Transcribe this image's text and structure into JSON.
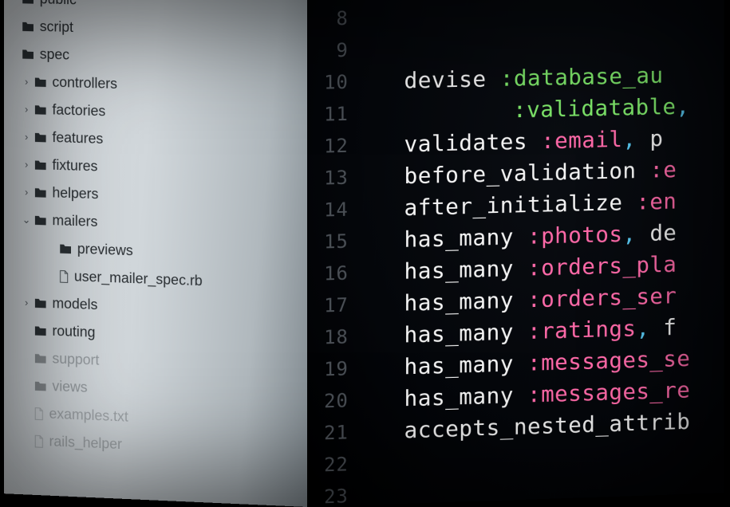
{
  "sidebar": {
    "items": [
      {
        "label": "public",
        "depth": 0,
        "arrow": "",
        "icon": "folder",
        "cls": ""
      },
      {
        "label": "script",
        "depth": 0,
        "arrow": "",
        "icon": "folder",
        "cls": ""
      },
      {
        "label": "spec",
        "depth": 0,
        "arrow": "",
        "icon": "folder",
        "cls": ""
      },
      {
        "label": "controllers",
        "depth": 1,
        "arrow": "›",
        "icon": "folder",
        "cls": ""
      },
      {
        "label": "factories",
        "depth": 1,
        "arrow": "›",
        "icon": "folder",
        "cls": ""
      },
      {
        "label": "features",
        "depth": 1,
        "arrow": "›",
        "icon": "folder",
        "cls": ""
      },
      {
        "label": "fixtures",
        "depth": 1,
        "arrow": "›",
        "icon": "folder",
        "cls": ""
      },
      {
        "label": "helpers",
        "depth": 1,
        "arrow": "›",
        "icon": "folder",
        "cls": ""
      },
      {
        "label": "mailers",
        "depth": 1,
        "arrow": "⌄",
        "icon": "folder",
        "cls": ""
      },
      {
        "label": "previews",
        "depth": 2,
        "arrow": "",
        "icon": "folder",
        "cls": ""
      },
      {
        "label": "user_mailer_spec.rb",
        "depth": 2,
        "arrow": "",
        "icon": "file",
        "cls": ""
      },
      {
        "label": "models",
        "depth": 1,
        "arrow": "›",
        "icon": "folder",
        "cls": ""
      },
      {
        "label": "routing",
        "depth": 1,
        "arrow": "",
        "icon": "folder",
        "cls": ""
      },
      {
        "label": "support",
        "depth": 1,
        "arrow": "",
        "icon": "folder",
        "cls": "faded"
      },
      {
        "label": "views",
        "depth": 1,
        "arrow": "",
        "icon": "folder",
        "cls": "faded"
      },
      {
        "label": "examples.txt",
        "depth": 1,
        "arrow": "",
        "icon": "file",
        "cls": "veryfaded"
      },
      {
        "label": "rails_helper",
        "depth": 1,
        "arrow": "",
        "icon": "file",
        "cls": "veryfaded"
      }
    ]
  },
  "editor": {
    "line_numbers": [
      "8",
      "9",
      "10",
      "11",
      "12",
      "13",
      "14",
      "15",
      "16",
      "17",
      "18",
      "19",
      "20",
      "21",
      "22",
      "23"
    ],
    "lines": [
      {
        "tokens": []
      },
      {
        "tokens": []
      },
      {
        "tokens": [
          {
            "t": "indent"
          },
          {
            "t": "kw",
            "v": "devise "
          },
          {
            "t": "sym2",
            "v": ":database_au"
          }
        ]
      },
      {
        "tokens": [
          {
            "t": "bigindent"
          },
          {
            "t": "sym2",
            "v": ":validatable"
          },
          {
            "t": "pun",
            "v": ","
          }
        ]
      },
      {
        "tokens": [
          {
            "t": "indent"
          },
          {
            "t": "kw",
            "v": "validates "
          },
          {
            "t": "sym",
            "v": ":email"
          },
          {
            "t": "pun",
            "v": ", "
          },
          {
            "t": "plain",
            "v": "p"
          }
        ]
      },
      {
        "tokens": [
          {
            "t": "indent"
          },
          {
            "t": "kw",
            "v": "before_validation "
          },
          {
            "t": "sym",
            "v": ":e"
          }
        ]
      },
      {
        "tokens": [
          {
            "t": "indent"
          },
          {
            "t": "kw",
            "v": "after_initialize "
          },
          {
            "t": "sym",
            "v": ":en"
          }
        ]
      },
      {
        "tokens": [
          {
            "t": "indent"
          },
          {
            "t": "kw",
            "v": "has_many "
          },
          {
            "t": "sym",
            "v": ":photos"
          },
          {
            "t": "pun",
            "v": ", "
          },
          {
            "t": "plain",
            "v": "de"
          }
        ]
      },
      {
        "tokens": [
          {
            "t": "indent"
          },
          {
            "t": "kw",
            "v": "has_many "
          },
          {
            "t": "sym",
            "v": ":orders_pla"
          }
        ]
      },
      {
        "tokens": [
          {
            "t": "indent"
          },
          {
            "t": "kw",
            "v": "has_many "
          },
          {
            "t": "sym",
            "v": ":orders_ser"
          }
        ]
      },
      {
        "tokens": [
          {
            "t": "indent"
          },
          {
            "t": "kw",
            "v": "has_many "
          },
          {
            "t": "sym",
            "v": ":ratings"
          },
          {
            "t": "pun",
            "v": ", "
          },
          {
            "t": "plain",
            "v": "f"
          }
        ]
      },
      {
        "tokens": [
          {
            "t": "indent"
          },
          {
            "t": "kw",
            "v": "has_many "
          },
          {
            "t": "sym",
            "v": ":messages_se"
          }
        ]
      },
      {
        "tokens": [
          {
            "t": "indent"
          },
          {
            "t": "kw",
            "v": "has_many "
          },
          {
            "t": "sym",
            "v": ":messages_re"
          }
        ]
      },
      {
        "tokens": [
          {
            "t": "indent"
          },
          {
            "t": "kw",
            "v": "accepts_nested_attrib"
          }
        ]
      },
      {
        "tokens": []
      },
      {
        "tokens": []
      }
    ]
  }
}
